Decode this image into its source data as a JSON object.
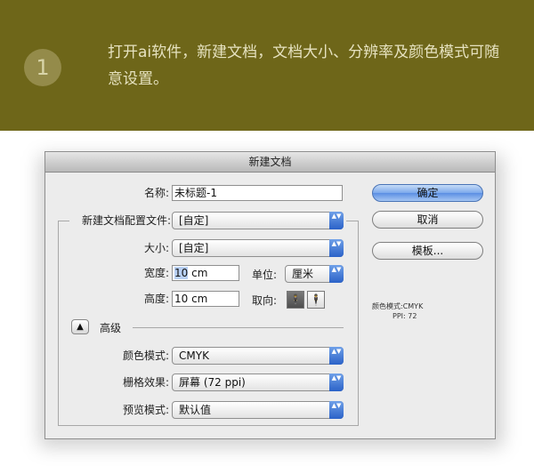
{
  "banner": {
    "step_number": "1",
    "description": "打开ai软件，新建文档，文档大小、分辨率及颜色模式可随意设置。"
  },
  "dialog": {
    "title": "新建文档",
    "name_label": "名称:",
    "name_value": "未标题-1",
    "profile_label": "新建文档配置文件:",
    "profile_value": "[自定]",
    "size_label": "大小:",
    "size_value": "[自定]",
    "width_label": "宽度:",
    "width_value_num": "10",
    "width_value_unit": " cm",
    "units_label": "单位:",
    "units_value": "厘米",
    "height_label": "高度:",
    "height_value": "10 cm",
    "orientation_label": "取向:",
    "advanced_label": "高级",
    "color_mode_label": "颜色模式:",
    "color_mode_value": "CMYK",
    "raster_label": "栅格效果:",
    "raster_value": "屏幕 (72 ppi)",
    "preview_label": "预览模式:",
    "preview_value": "默认值",
    "ok_button": "确定",
    "cancel_button": "取消",
    "templates_button": "模板...",
    "info_color_mode": "颜色模式:CMYK",
    "info_ppi": "PPI: 72",
    "disclosure_glyph": "▲",
    "orient_portrait_glyph": "🕴",
    "orient_landscape_glyph": "🕴",
    "select_arrow_glyph": "▲▼"
  },
  "colors": {
    "banner_bg": "#6e6619",
    "accent_blue": "#5b8fe3"
  }
}
